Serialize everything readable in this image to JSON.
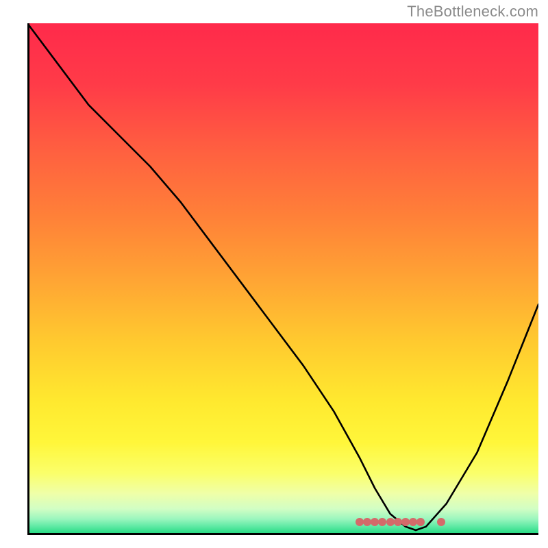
{
  "attribution": "TheBottleneck.com",
  "chart_data": {
    "type": "line",
    "title": "",
    "xlabel": "",
    "ylabel": "",
    "xlim": [
      0,
      100
    ],
    "ylim": [
      0,
      100
    ],
    "series": [
      {
        "name": "curve",
        "x": [
          0,
          6,
          12,
          18,
          24,
          30,
          36,
          42,
          48,
          54,
          60,
          65,
          68,
          71,
          74,
          76,
          78,
          82,
          88,
          94,
          100
        ],
        "y": [
          100,
          92,
          84,
          78,
          72,
          65,
          57,
          49,
          41,
          33,
          24,
          15,
          9,
          4,
          1.5,
          0.8,
          1.5,
          6,
          16,
          30,
          45
        ]
      }
    ],
    "markers": {
      "name": "recommended-range",
      "y": 2.4,
      "x": [
        65,
        66.5,
        68,
        69.5,
        71,
        72.5,
        74,
        75.5,
        77,
        81
      ]
    },
    "gradient_stops": [
      {
        "pos": 0,
        "color": "#ff2a4b"
      },
      {
        "pos": 50,
        "color": "#ffa434"
      },
      {
        "pos": 82,
        "color": "#fff63a"
      },
      {
        "pos": 100,
        "color": "#1fd97f"
      }
    ]
  }
}
